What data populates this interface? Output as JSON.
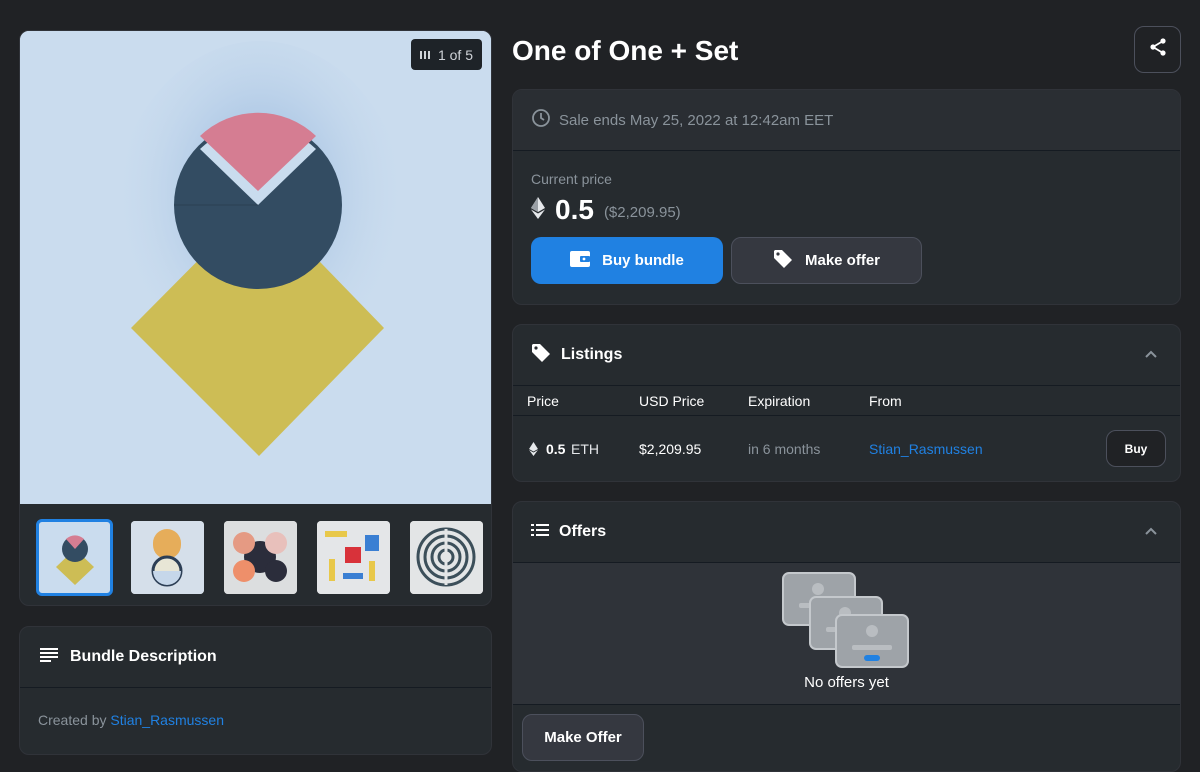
{
  "media": {
    "counter": "1 of 5"
  },
  "bundle": {
    "header": "Bundle Description",
    "created_by_prefix": "Created by",
    "creator": "Stian_Rasmussen"
  },
  "title": "One of One + Set",
  "sale": {
    "ends_text": "Sale ends May 25, 2022 at 12:42am EET",
    "price_label": "Current price",
    "price": "0.5",
    "price_usd": "($2,209.95)",
    "buy_label": "Buy bundle",
    "offer_label": "Make offer"
  },
  "listings": {
    "header": "Listings",
    "columns": [
      "Price",
      "USD Price",
      "Expiration",
      "From"
    ],
    "rows": [
      {
        "price": "0.5",
        "unit": "ETH",
        "usd": "$2,209.95",
        "expiration": "in 6 months",
        "from": "Stian_Rasmussen",
        "action": "Buy"
      }
    ]
  },
  "offers": {
    "header": "Offers",
    "empty_text": "No offers yet",
    "make_offer_label": "Make Offer"
  },
  "colors": {
    "accent": "#2081e2",
    "background": "#202225",
    "card": "#262b2f"
  }
}
